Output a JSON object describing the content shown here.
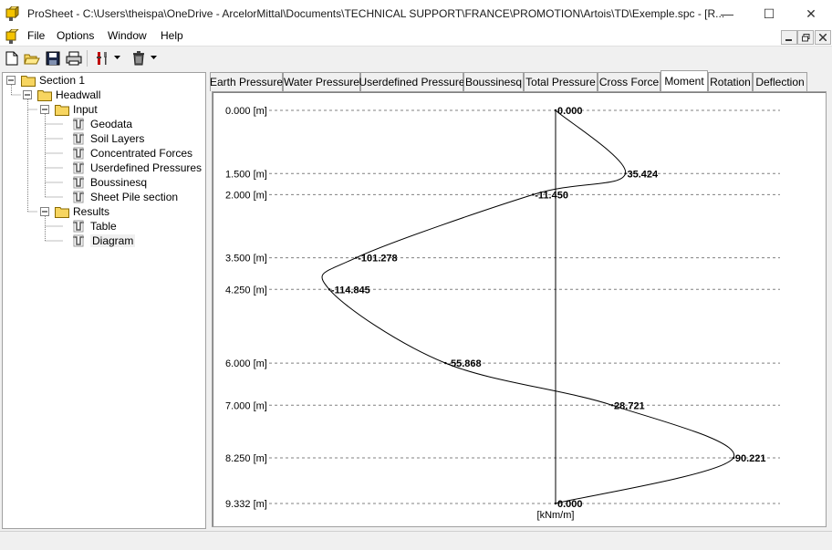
{
  "window": {
    "title": "ProSheet - C:\\Users\\theispa\\OneDrive - ArcelorMittal\\Documents\\TECHNICAL SUPPORT\\FRANCE\\PROMOTION\\Artois\\TD\\Exemple.spc - [R...",
    "minimize_glyph": "—",
    "maximize_glyph": "☐",
    "close_glyph": "✕"
  },
  "menu": {
    "file": "File",
    "options": "Options",
    "window": "Window",
    "help": "Help"
  },
  "tree": {
    "section": "Section 1",
    "headwall": "Headwall",
    "input": "Input",
    "input_items": [
      "Geodata",
      "Soil Layers",
      "Concentrated Forces",
      "Userdefined Pressures",
      "Boussinesq",
      "Sheet Pile section"
    ],
    "results": "Results",
    "results_items": [
      "Table",
      "Diagram"
    ]
  },
  "tabs": [
    "Earth Pressure",
    "Water Pressure",
    "Userdefined Pressure",
    "Boussinesq",
    "Total Pressure",
    "Cross Force",
    "Moment",
    "Rotation",
    "Deflection"
  ],
  "active_tab": "Moment",
  "chart_data": {
    "type": "line",
    "depth_labels": [
      "0.000 [m]",
      "1.500 [m]",
      "2.000 [m]",
      "3.500 [m]",
      "4.250 [m]",
      "6.000 [m]",
      "7.000 [m]",
      "8.250 [m]",
      "9.332 [m]"
    ],
    "depths": [
      0.0,
      1.5,
      2.0,
      3.5,
      4.25,
      6.0,
      7.0,
      8.25,
      9.332
    ],
    "moments": [
      0.0,
      35.424,
      -11.45,
      -101.278,
      -114.845,
      -55.868,
      28.721,
      90.221,
      0.0
    ],
    "value_labels": [
      "0.000",
      "35.424",
      "-11.450",
      "-101.278",
      "-114.845",
      "-55.868",
      "28.721",
      "90.221",
      "0.000"
    ],
    "unit_label": "[kNm/m]",
    "grid": "dashed horizontal at each depth"
  }
}
